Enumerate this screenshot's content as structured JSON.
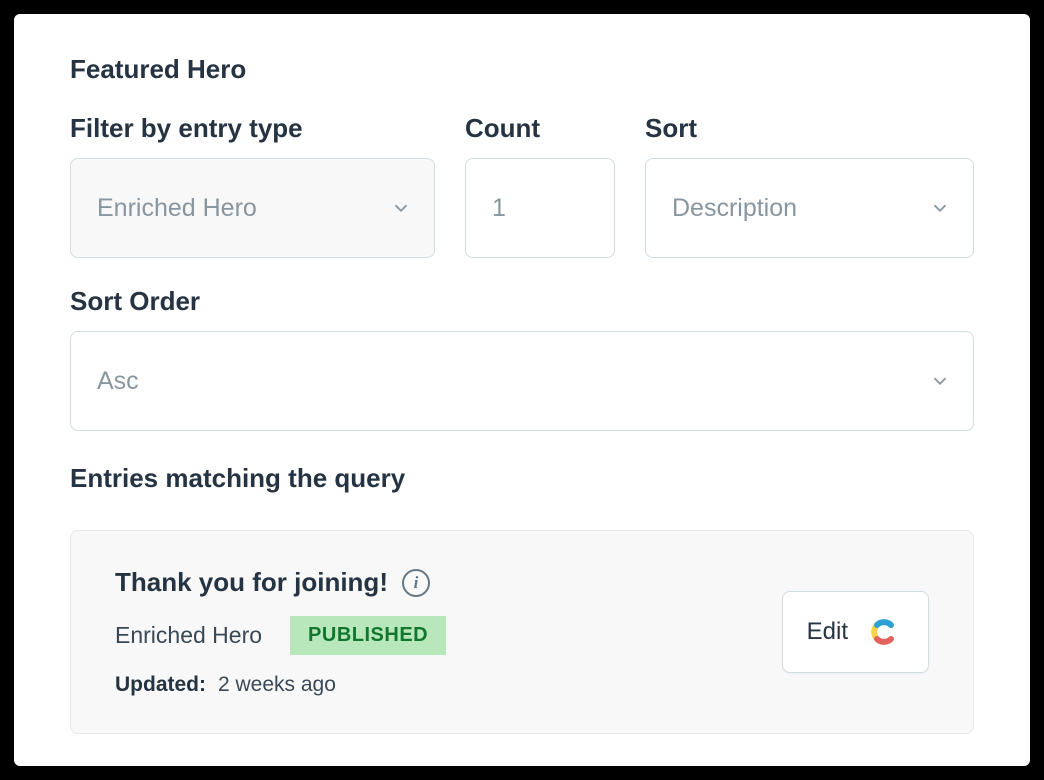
{
  "section_title": "Featured Hero",
  "filters": {
    "entry_type": {
      "label": "Filter by entry type",
      "value": "Enriched Hero"
    },
    "count": {
      "label": "Count",
      "value": "1"
    },
    "sort": {
      "label": "Sort",
      "value": "Description"
    },
    "sort_order": {
      "label": "Sort Order",
      "value": "Asc"
    }
  },
  "entries_label": "Entries matching the query",
  "entry": {
    "title": "Thank you for joining!",
    "type": "Enriched Hero",
    "status": "PUBLISHED",
    "updated_label": "Updated:",
    "updated_value": "2 weeks ago",
    "edit_label": "Edit"
  }
}
